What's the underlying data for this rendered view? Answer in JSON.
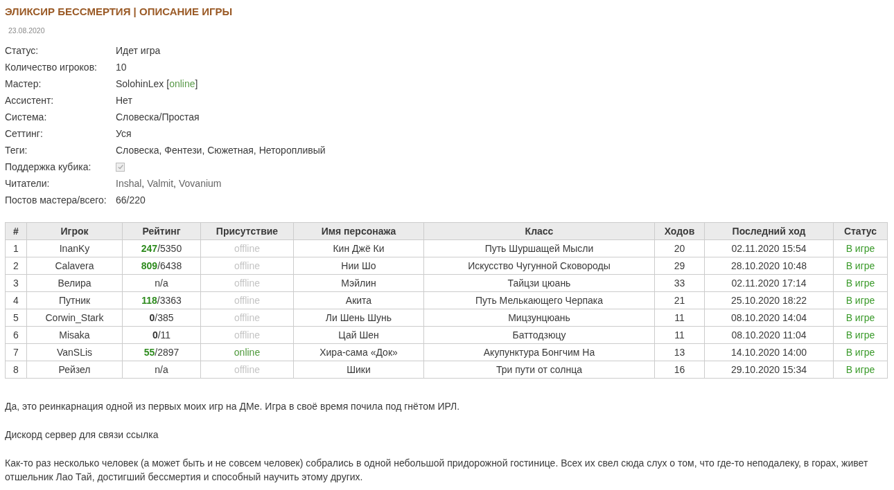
{
  "title": "ЭЛИКСИР БЕССМЕРТИЯ | ОПИСАНИЕ ИГРЫ",
  "date": "23.08.2020",
  "info": [
    {
      "kind": "text",
      "label": "Статус:",
      "value": "Идет игра"
    },
    {
      "kind": "text",
      "label": "Количество игроков:",
      "value": "10"
    },
    {
      "kind": "user",
      "label": "Мастер:",
      "value": "SolohinLex",
      "online": true,
      "open": "[",
      "presence": "online",
      "close": "]"
    },
    {
      "kind": "text",
      "label": "Ассистент:",
      "value": "Нет"
    },
    {
      "kind": "text",
      "label": "Система:",
      "value": "Словеска/Простая"
    },
    {
      "kind": "text",
      "label": "Сеттинг:",
      "value": "Уся"
    },
    {
      "kind": "text",
      "label": "Теги:",
      "value": "Словеска, Фентези, Сюжетная, Неторопливый"
    },
    {
      "kind": "checkbox",
      "label": "Поддержка кубика:",
      "checked": true
    },
    {
      "kind": "links",
      "label": "Читатели:",
      "links": [
        "Inshal",
        "Valmit",
        "Vovanium"
      ],
      "separator": ","
    },
    {
      "kind": "text",
      "label": "Постов мастера/всего:",
      "value": "66/220"
    }
  ],
  "table": {
    "columns": [
      "#",
      "Игрок",
      "Рейтинг",
      "Присутствие",
      "Имя персонажа",
      "Класс",
      "Ходов",
      "Последний ход",
      "Статус"
    ],
    "rows": [
      {
        "num": "1",
        "player": "InanKy",
        "rating": {
          "kind": "score",
          "score": "247",
          "total": "/5350",
          "color": "#2e8b1e"
        },
        "presence": "offline",
        "online": false,
        "character": "Кин Джё Ки",
        "class": "Путь Шуршащей Мысли",
        "moves": "20",
        "last": "02.11.2020 15:54",
        "status": "В игре"
      },
      {
        "num": "2",
        "player": "Calavera",
        "rating": {
          "kind": "score",
          "score": "809",
          "total": "/6438",
          "color": "#2e8b1e"
        },
        "presence": "offline",
        "online": false,
        "character": "Нии Шо",
        "class": "Искусство Чугунной Сковороды",
        "moves": "29",
        "last": "28.10.2020 10:48",
        "status": "В игре"
      },
      {
        "num": "3",
        "player": "Велира",
        "rating": {
          "kind": "text",
          "text": "n/a"
        },
        "presence": "offline",
        "online": false,
        "character": "Мэйлин",
        "class": "Тайцзи цюань",
        "moves": "33",
        "last": "02.11.2020 17:14",
        "status": "В игре"
      },
      {
        "num": "4",
        "player": "Путник",
        "rating": {
          "kind": "score",
          "score": "118",
          "total": "/3363",
          "color": "#2e8b1e"
        },
        "presence": "offline",
        "online": false,
        "character": "Акита",
        "class": "Путь Мелькающего Черпака",
        "moves": "21",
        "last": "25.10.2020 18:22",
        "status": "В игре"
      },
      {
        "num": "5",
        "player": "Corwin_Stark",
        "rating": {
          "kind": "score",
          "score": "0",
          "total": "/385",
          "color": "#333333"
        },
        "presence": "offline",
        "online": false,
        "character": "Ли Шень Шунь",
        "class": "Мицзунцюань",
        "moves": "11",
        "last": "08.10.2020 14:04",
        "status": "В игре"
      },
      {
        "num": "6",
        "player": "Misaka",
        "rating": {
          "kind": "score",
          "score": "0",
          "total": "/11",
          "color": "#333333"
        },
        "presence": "offline",
        "online": false,
        "character": "Цай Шен",
        "class": "Баттодзюцу",
        "moves": "11",
        "last": "08.10.2020 11:04",
        "status": "В игре"
      },
      {
        "num": "7",
        "player": "VanSLis",
        "rating": {
          "kind": "score",
          "score": "55",
          "total": "/2897",
          "color": "#2e8b1e"
        },
        "presence": "online",
        "online": true,
        "character": "Хира-сама «Док»",
        "class": "Акупунктура Бонгчим На",
        "moves": "13",
        "last": "14.10.2020 14:00",
        "status": "В игре"
      },
      {
        "num": "8",
        "player": "Рейзел",
        "rating": {
          "kind": "text",
          "text": "n/a"
        },
        "presence": "offline",
        "online": false,
        "character": "Шики",
        "class": "Три пути от солнца",
        "moves": "16",
        "last": "29.10.2020 15:34",
        "status": "В игре"
      }
    ]
  },
  "paragraphs": [
    "Да, это реинкарнация одной из первых моих игр на ДМе. Игра в своё время почила под гнётом ИРЛ.",
    "Дискорд сервер для связи ссылка",
    "Как-то раз несколько человек (а может быть и не совсем человек) собрались в одной небольшой придорожной гостинице. Всех их свел сюда слух о том, что где-то неподалеку, в горах, живет отшельник Лао Тай, достигший бессмертия и способный научить этому других."
  ]
}
